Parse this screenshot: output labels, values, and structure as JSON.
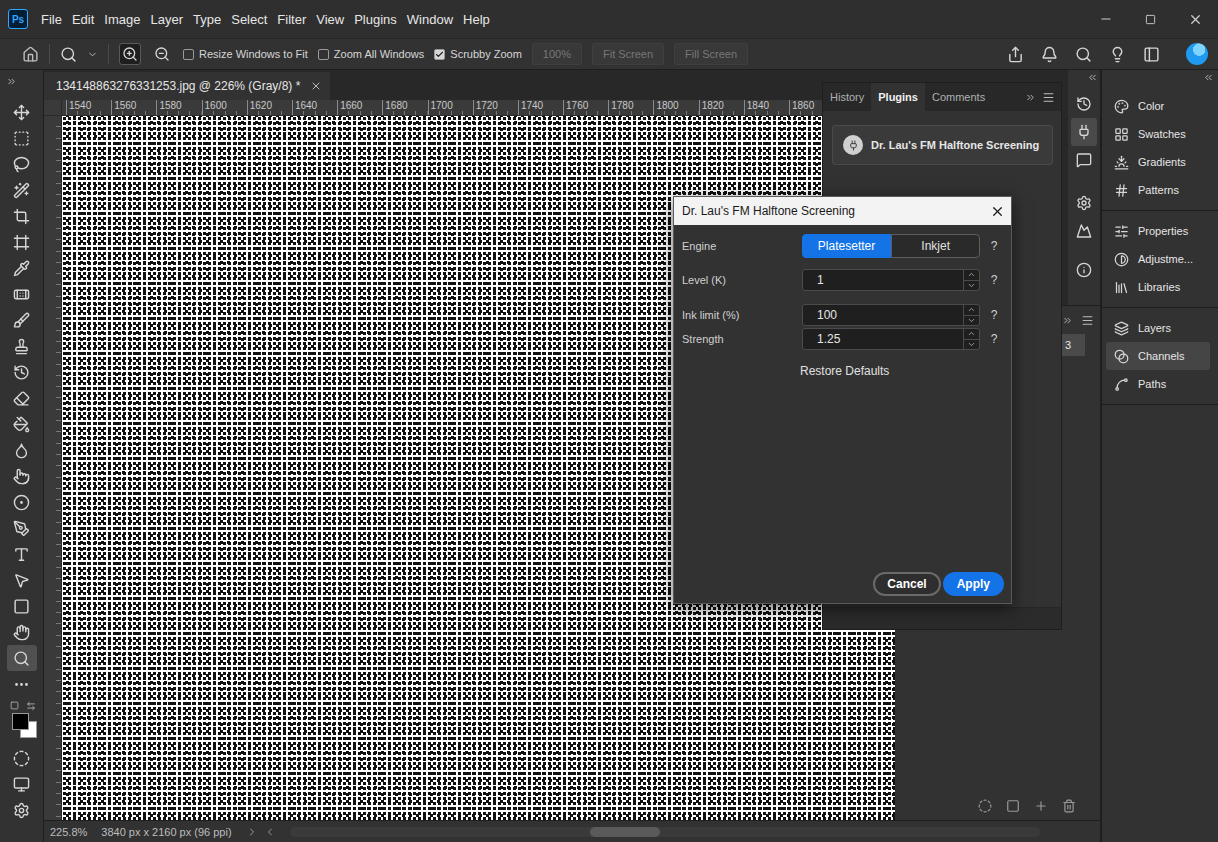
{
  "app": {
    "logo": "Ps"
  },
  "menu": [
    "File",
    "Edit",
    "Image",
    "Layer",
    "Type",
    "Select",
    "Filter",
    "View",
    "Plugins",
    "Window",
    "Help"
  ],
  "options_bar": {
    "zoom_modes": [
      {
        "selected": true
      },
      {
        "selected": false
      }
    ],
    "checkboxes": [
      {
        "label": "Resize Windows to Fit",
        "checked": false
      },
      {
        "label": "Zoom All Windows",
        "checked": false
      },
      {
        "label": "Scrubby Zoom",
        "checked": true
      }
    ],
    "buttons": [
      {
        "label": "100%",
        "disabled": true
      },
      {
        "label": "Fit Screen",
        "disabled": true
      },
      {
        "label": "Fill Screen",
        "disabled": true
      }
    ]
  },
  "toolbar": {
    "tools": [
      {
        "selected": false
      },
      {
        "selected": false
      },
      {
        "selected": false
      },
      {
        "selected": false
      },
      {
        "selected": false
      },
      {
        "selected": false
      },
      {
        "selected": false
      },
      {
        "selected": false
      },
      {
        "selected": false
      },
      {
        "selected": false
      },
      {
        "selected": false
      },
      {
        "selected": false
      },
      {
        "selected": false
      },
      {
        "selected": false
      },
      {
        "selected": false
      },
      {
        "selected": false
      },
      {
        "selected": false
      },
      {
        "selected": false
      },
      {
        "selected": false
      },
      {
        "selected": false
      },
      {
        "selected": false
      },
      {
        "selected": true
      },
      {
        "selected": false
      }
    ],
    "swatches": [
      {
        "color": "#000000"
      },
      {
        "color": "#ffffff"
      }
    ]
  },
  "document": {
    "tab": "134148863276331253.jpg @ 226% (Gray/8) *",
    "ruler": [
      "1540",
      "1560",
      "1580",
      "1600",
      "1620",
      "1640",
      "1660",
      "1680",
      "1700",
      "1720",
      "1740",
      "1760",
      "1780",
      "1800",
      "1820",
      "1840",
      "1860"
    ]
  },
  "status_bar": {
    "zoom": "225.8%",
    "info": "3840 px x 2160 px (96 ppi)"
  },
  "plugins_panel": {
    "tabs": [
      {
        "label": "History",
        "selected": false
      },
      {
        "label": "Plugins",
        "selected": true
      },
      {
        "label": "Comments",
        "selected": false
      }
    ],
    "plugins": [
      "Dr. Lau's FM Halftone Screening"
    ]
  },
  "icon_strip": [
    {
      "selected": false
    },
    {
      "selected": true
    },
    {
      "selected": false
    },
    {
      "selected": false
    },
    {
      "selected": false
    },
    {
      "selected": false
    }
  ],
  "dock_panel": {
    "row": "3"
  },
  "right_panel": {
    "groups": [
      [
        {
          "label": "Color",
          "selected": false
        },
        {
          "label": "Swatches",
          "selected": false
        },
        {
          "label": "Gradients",
          "selected": false
        },
        {
          "label": "Patterns",
          "selected": false
        }
      ],
      [
        {
          "label": "Properties",
          "selected": false
        },
        {
          "label": "Adjustme...",
          "selected": false
        },
        {
          "label": "Libraries",
          "selected": false
        }
      ],
      [
        {
          "label": "Layers",
          "selected": false
        },
        {
          "label": "Channels",
          "selected": true
        },
        {
          "label": "Paths",
          "selected": false
        }
      ]
    ]
  },
  "dialog": {
    "title": "Dr. Lau's FM Halftone Screening",
    "fields": [
      {
        "label": "Engine",
        "kind": "segmented",
        "options": [
          {
            "label": "Platesetter",
            "selected": true
          },
          {
            "label": "Inkjet",
            "selected": false
          }
        ],
        "help": "?"
      },
      {
        "label": "Level (K)",
        "kind": "number",
        "value": "1",
        "help": "?"
      },
      {
        "label": "Ink limit (%)",
        "kind": "number",
        "value": "100",
        "help": "?"
      },
      {
        "label": "Strength",
        "kind": "number",
        "value": "1.25",
        "help": "?"
      }
    ],
    "link": "Restore Defaults",
    "buttons": [
      {
        "label": "Cancel",
        "primary": false
      },
      {
        "label": "Apply",
        "primary": true
      }
    ]
  }
}
